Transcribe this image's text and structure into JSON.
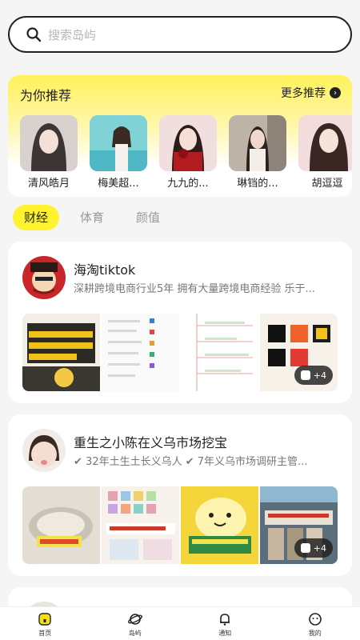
{
  "search": {
    "placeholder": "搜索岛屿"
  },
  "recommend": {
    "title": "为你推荐",
    "more_label": "更多推荐",
    "items": [
      {
        "name": "清风皓月"
      },
      {
        "name": "梅美超..."
      },
      {
        "name": "九九的..."
      },
      {
        "name": "琳铛的..."
      },
      {
        "name": "胡逗逗"
      }
    ]
  },
  "tabs": [
    {
      "label": "财经"
    },
    {
      "label": "体育"
    },
    {
      "label": "颜值"
    }
  ],
  "cards": [
    {
      "name": "海淘tiktok",
      "desc": "深耕跨境电商行业5年 拥有大量跨境电商经验 乐于...",
      "more_count": "+4"
    },
    {
      "name": "重生之小陈在义乌市场挖宝",
      "tag1": "32年土生土长义乌人",
      "tag2": "7年义乌市场调研主管...",
      "more_count": "+4"
    }
  ],
  "nav": [
    {
      "label": "首页"
    },
    {
      "label": "岛屿"
    },
    {
      "label": "通知"
    },
    {
      "label": "我的"
    }
  ],
  "colors": {
    "accent": "#fff22e",
    "background": "#f5f5f5"
  }
}
